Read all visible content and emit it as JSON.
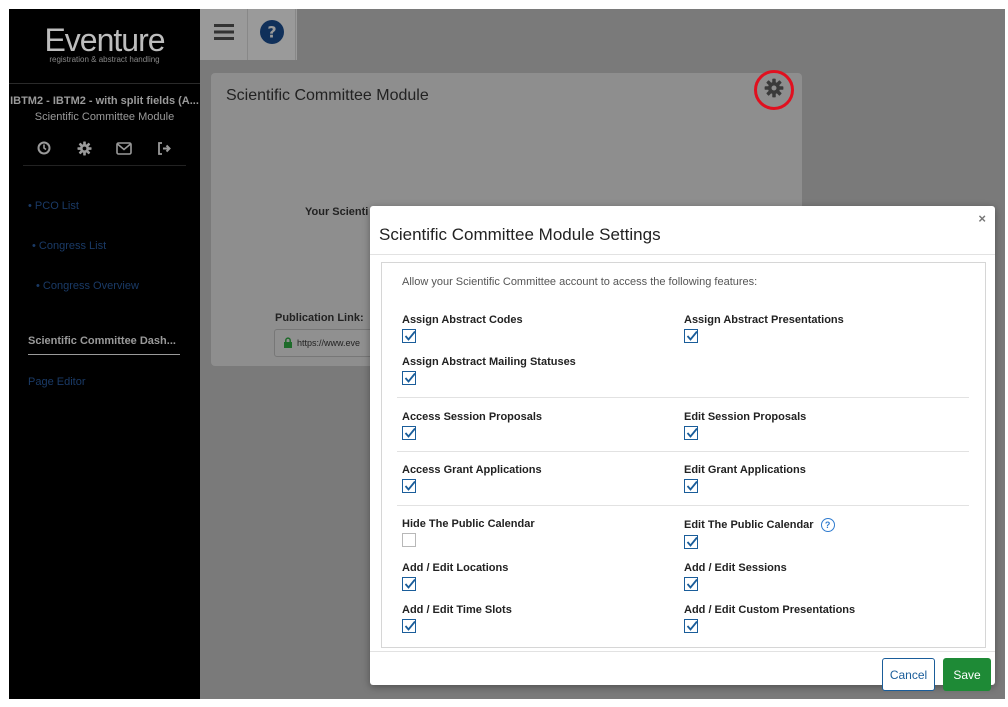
{
  "app": {
    "logo_name": "Eventure",
    "logo_tagline": "registration & abstract handling"
  },
  "sidebar": {
    "event_name": "IBTM2 - IBTM2 - with split fields (A...",
    "module_name": "Scientific Committee Module",
    "icons": [
      "clock-icon",
      "gear-icon",
      "envelope-icon",
      "sign-out-icon"
    ],
    "nav": {
      "pco_list": "• PCO List",
      "congress_list": "• Congress List",
      "congress_overview": "• Congress Overview",
      "dashboard": "Scientific Committee Dash...",
      "page_editor": "Page Editor"
    }
  },
  "toolbar": {
    "icons": [
      "hamburger-menu-icon",
      "help-icon"
    ]
  },
  "panel": {
    "title": "Scientific Committee Module",
    "session_text": "Your Scienti",
    "publication_label": "Publication Link:",
    "publication_value": "https://www.eve"
  },
  "modal": {
    "title": "Scientific Committee Module Settings",
    "close": "×",
    "intro": "Allow your Scientific Committee account to access the following features:",
    "features": {
      "assign_abstract_codes": {
        "label": "Assign Abstract Codes",
        "checked": true
      },
      "assign_abstract_presentations": {
        "label": "Assign Abstract Presentations",
        "checked": true
      },
      "assign_abstract_mailing_statuses": {
        "label": "Assign Abstract Mailing Statuses",
        "checked": true
      },
      "access_session_proposals": {
        "label": "Access Session Proposals",
        "checked": true
      },
      "edit_session_proposals": {
        "label": "Edit Session Proposals",
        "checked": true
      },
      "access_grant_applications": {
        "label": "Access Grant Applications",
        "checked": true
      },
      "edit_grant_applications": {
        "label": "Edit Grant Applications",
        "checked": true
      },
      "hide_public_calendar": {
        "label": "Hide The Public Calendar",
        "checked": false
      },
      "edit_public_calendar": {
        "label": "Edit The Public Calendar",
        "checked": true
      },
      "add_edit_locations": {
        "label": "Add / Edit Locations",
        "checked": true
      },
      "add_edit_sessions": {
        "label": "Add / Edit Sessions",
        "checked": true
      },
      "add_edit_time_slots": {
        "label": "Add / Edit Time Slots",
        "checked": true
      },
      "add_edit_custom_presentations": {
        "label": "Add / Edit Custom Presentations",
        "checked": true
      }
    },
    "cancel_label": "Cancel",
    "save_label": "Save"
  },
  "colors": {
    "accent": "#1a5d9a",
    "save": "#1e8a36",
    "highlight": "#e0101f",
    "help": "#2f7bcf"
  }
}
